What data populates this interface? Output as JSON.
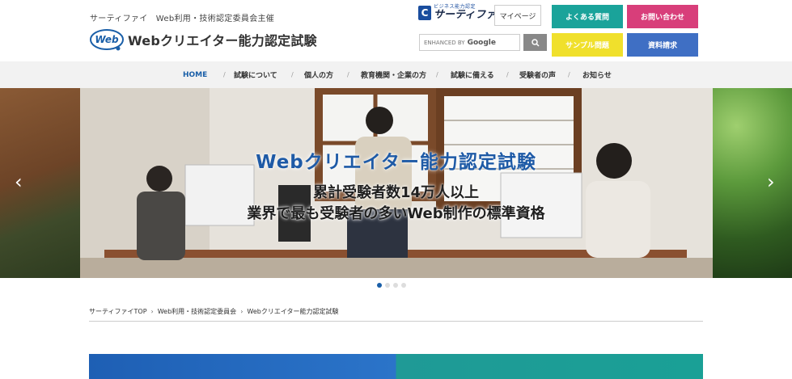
{
  "header": {
    "org_line": "サーティファイ　Web利用・技術認定委員会主催",
    "logo_badge": "Web",
    "logo_title": "Webクリエイター能力認定試験",
    "cert_logo_small": "ビジネス能力認定",
    "cert_logo_name": "サーティファイ",
    "cert_logo_mark": "C",
    "mypage": "マイページ",
    "search": {
      "prefix": "ENHANCED BY",
      "brand": "Google"
    },
    "buttons": {
      "faq": "よくある質問",
      "contact": "お問い合わせ",
      "sample": "サンプル問題",
      "request": "資料請求"
    }
  },
  "nav": {
    "items": [
      "HOME",
      "試験について",
      "個人の方",
      "教育機関・企業の方",
      "試験に備える",
      "受験者の声",
      "お知らせ"
    ],
    "active_index": 0
  },
  "hero": {
    "title": "Webクリエイター能力認定試験",
    "subtitle_1": "累計受験者数14万人以上",
    "subtitle_2": "業界で最も受験者の多いWeb制作の標準資格",
    "prev_arrow": "‹",
    "next_arrow": "›",
    "slide_count": 4,
    "active_slide": 0
  },
  "breadcrumb": [
    "サーティファイTOP",
    "Web利用・技術認定委員会",
    "Webクリエイター能力認定試験"
  ],
  "colors": {
    "faq": "#1aa39a",
    "contact": "#d83e7a",
    "sample": "#f0e02c",
    "request": "#3f6fc4",
    "accent": "#1a5fa8"
  }
}
